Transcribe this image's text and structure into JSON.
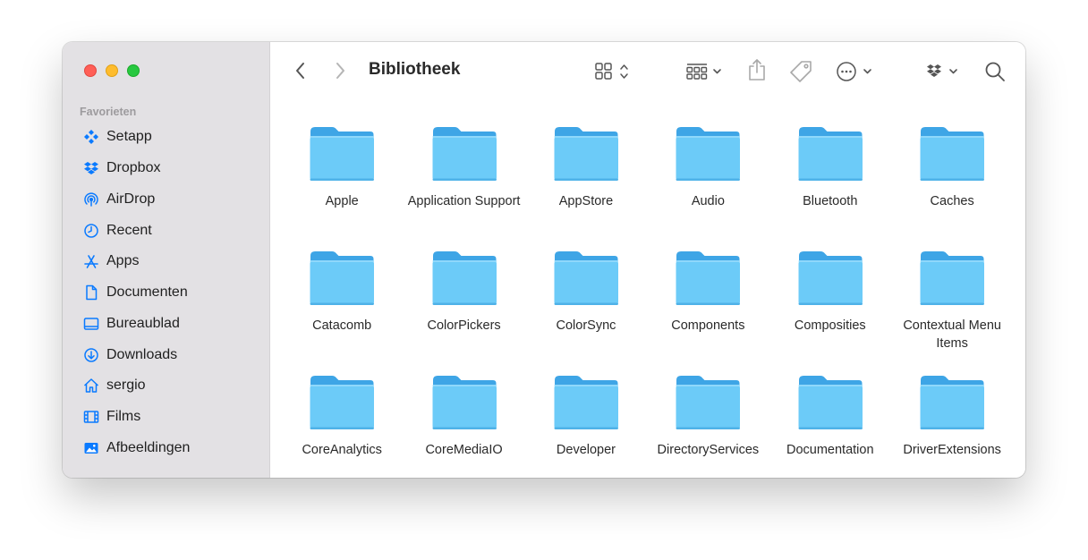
{
  "window": {
    "title": "Bibliotheek"
  },
  "sidebar": {
    "section_label": "Favorieten",
    "items": [
      {
        "label": "Setapp",
        "icon": "setapp-icon"
      },
      {
        "label": "Dropbox",
        "icon": "dropbox-icon"
      },
      {
        "label": "AirDrop",
        "icon": "airdrop-icon"
      },
      {
        "label": "Recent",
        "icon": "clock-icon"
      },
      {
        "label": "Apps",
        "icon": "apps-icon"
      },
      {
        "label": "Documenten",
        "icon": "document-icon"
      },
      {
        "label": "Bureaublad",
        "icon": "desktop-icon"
      },
      {
        "label": "Downloads",
        "icon": "download-icon"
      },
      {
        "label": "sergio",
        "icon": "home-icon"
      },
      {
        "label": "Films",
        "icon": "film-icon"
      },
      {
        "label": "Afbeeldingen",
        "icon": "photo-icon"
      }
    ]
  },
  "toolbar": {
    "back": "back-chevron-icon",
    "forward": "forward-chevron-icon",
    "view": "icon-view-grid-icon",
    "group": "group-by-icon",
    "share": "share-icon",
    "tag": "tag-icon",
    "more": "more-actions-icon",
    "dropbox": "dropbox-icon",
    "search": "search-icon"
  },
  "folders": [
    {
      "name": "Apple"
    },
    {
      "name": "Application Support"
    },
    {
      "name": "AppStore"
    },
    {
      "name": "Audio"
    },
    {
      "name": "Bluetooth"
    },
    {
      "name": "Caches"
    },
    {
      "name": "Catacomb"
    },
    {
      "name": "ColorPickers"
    },
    {
      "name": "ColorSync"
    },
    {
      "name": "Components"
    },
    {
      "name": "Composities"
    },
    {
      "name": "Contextual Menu Items"
    },
    {
      "name": "CoreAnalytics"
    },
    {
      "name": "CoreMediaIO"
    },
    {
      "name": "Developer"
    },
    {
      "name": "DirectoryServices"
    },
    {
      "name": "Documentation"
    },
    {
      "name": "DriverExtensions"
    }
  ],
  "colors": {
    "accent": "#0a7aff",
    "sidebar_bg": "#e3e1e4",
    "folder_back": "#3ea5e6",
    "folder_front": "#6ccbf8"
  }
}
